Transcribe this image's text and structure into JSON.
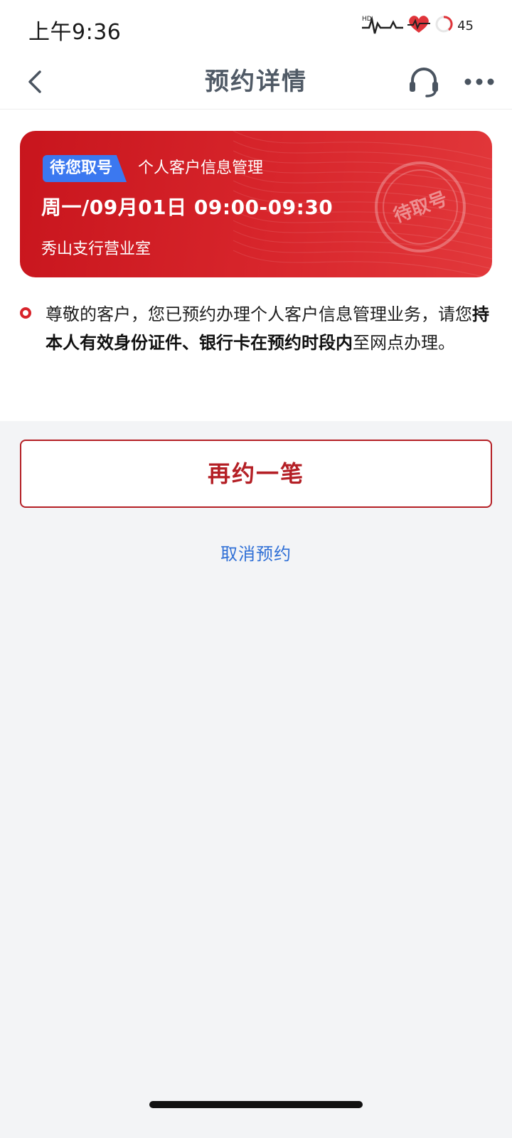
{
  "status_bar": {
    "time": "上午9:36",
    "battery": "45",
    "icons": [
      "hd-signal-icon",
      "heart-health-icon",
      "battery-icon"
    ]
  },
  "nav": {
    "title": "预约详情",
    "back_icon": "chevron-left-icon",
    "support_icon": "headset-icon",
    "more_icon": "more-dots-icon"
  },
  "booking": {
    "status_tag": "待您取号",
    "service": "个人客户信息管理",
    "datetime": "周一/09月01日 09:00-09:30",
    "branch": "秀山支行营业室",
    "stamp": "待取号",
    "colors": {
      "card": "#d8262c",
      "tag": "#3b78f0"
    }
  },
  "notice": {
    "part1": "尊敬的客户，您已预约办理个人客户信息管理业务，请您",
    "bold": "持本人有效身份证件、银行卡在预约时段内",
    "part2": "至网点办理。"
  },
  "actions": {
    "rebook": "再约一笔",
    "cancel": "取消预约",
    "colors": {
      "rebook": "#b41f25",
      "cancel": "#2f6fd6"
    }
  }
}
